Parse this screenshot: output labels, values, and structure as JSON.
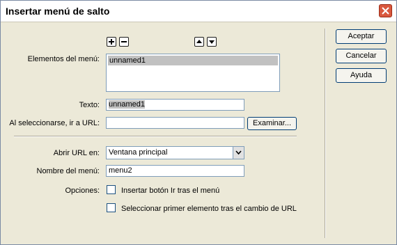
{
  "dialog": {
    "title": "Insertar menú de salto",
    "close_icon": "close-icon"
  },
  "toolbar": {
    "add_icon": "plus-icon",
    "remove_icon": "minus-icon",
    "move_up_icon": "arrow-up-icon",
    "move_down_icon": "arrow-down-icon"
  },
  "menu_items": {
    "label": "Elementos del menú:",
    "items": [
      "unnamed1"
    ],
    "selected_index": 0
  },
  "text_field": {
    "label": "Texto:",
    "value": "unnamed1"
  },
  "url_field": {
    "label": "Al seleccionarse, ir a URL:",
    "value": "",
    "browse_label": "Examinar..."
  },
  "open_in": {
    "label": "Abrir URL en:",
    "value": "Ventana principal"
  },
  "menu_name": {
    "label": "Nombre del menú:",
    "value": "menu2"
  },
  "options": {
    "label": "Opciones:",
    "insert_go_button": {
      "label": "Insertar botón Ir tras el menú",
      "checked": false
    },
    "select_first_item": {
      "label": "Seleccionar primer elemento tras el cambio de URL",
      "checked": false
    }
  },
  "buttons": {
    "ok": "Aceptar",
    "cancel": "Cancelar",
    "help": "Ayuda"
  },
  "colors": {
    "dialog_bg": "#ece9d8",
    "close_button": "#d9583e",
    "selection": "#c1c1c1",
    "field_border": "#7f9db9"
  }
}
